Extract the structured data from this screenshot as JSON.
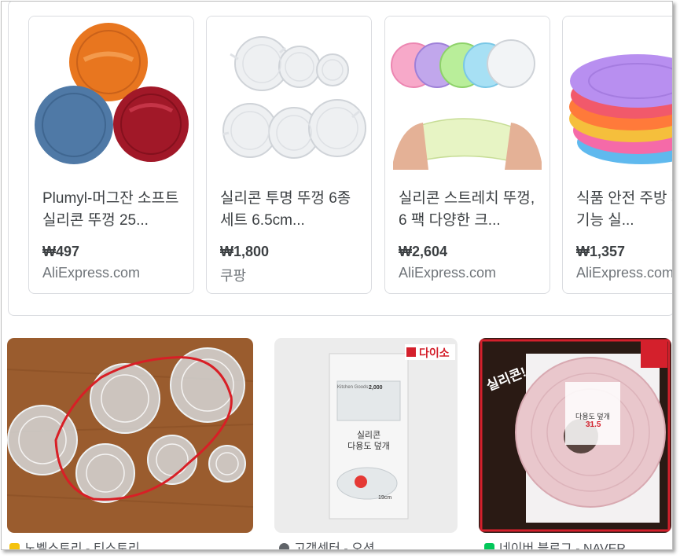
{
  "shopping": {
    "items": [
      {
        "title": "Plumyl-머그잔 소프트 실리콘 뚜껑 25...",
        "price": "₩497",
        "store": "AliExpress.com",
        "image": "colored-silicone-lids"
      },
      {
        "title": "실리콘 투명 뚜껑 6종 세트 6.5cm...",
        "price": "₩1,800",
        "store": "쿠팡",
        "image": "clear-silicone-lid-set"
      },
      {
        "title": "실리콘 스트레치 뚜껑, 6 팩 다양한 크...",
        "price": "₩2,604",
        "store": "AliExpress.com",
        "image": "stretch-lids-hands"
      },
      {
        "title": "식품 안전 주방 서리 다기능 실...",
        "price": "₩1,357",
        "store": "AliExpress.com",
        "image": "stacked-pastel-lids"
      }
    ]
  },
  "images": [
    {
      "source": "노벨스토리 - 티스토리",
      "image": "clear-lids-on-wood-circled",
      "favicon_color": "#f4c20d"
    },
    {
      "source": "고객센터 - 오션",
      "image": "daiso-lid-package",
      "favicon_color": "#5f6368",
      "badge": "다이소"
    },
    {
      "source": "네이버 블로그 - NAVER",
      "image": "pink-lid-package",
      "favicon_color": "#03c75a",
      "sticker": "실리콘!",
      "package_text": "다용도 덮개",
      "price_tag": "31.5"
    }
  ],
  "package": {
    "brand_line": "Kitchen Goods",
    "price": "2,000",
    "name1": "실리콘",
    "name2": "다용도 덮개",
    "size": "19cm"
  },
  "colors": {
    "card_border": "#dadce0",
    "title": "#3c4043",
    "store": "#70757a",
    "accent_red": "#d4202c"
  }
}
